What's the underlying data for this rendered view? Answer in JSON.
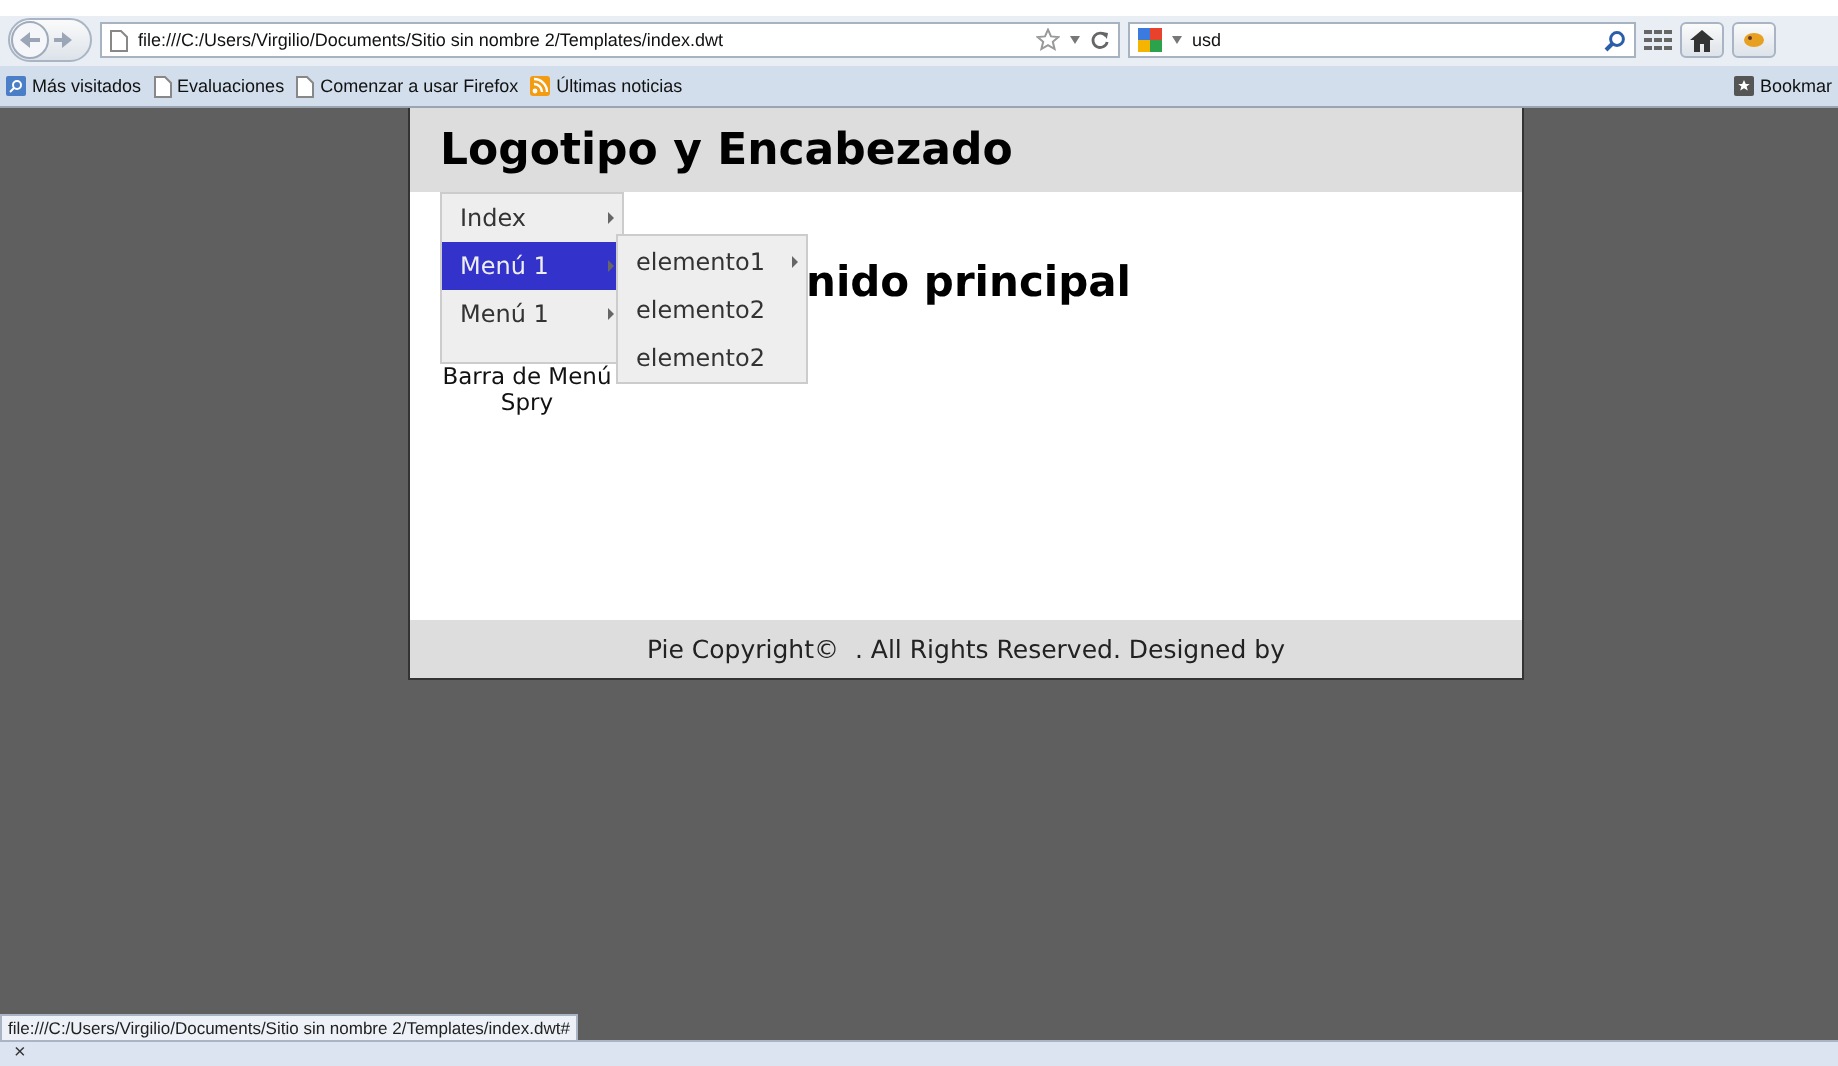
{
  "toolbar": {
    "address": "file:///C:/Users/Virgilio/Documents/Sitio sin nombre 2/Templates/index.dwt",
    "search_value": "usd"
  },
  "bookmarks": [
    {
      "label": "Más visitados",
      "kind": "smart"
    },
    {
      "label": "Evaluaciones",
      "kind": "page"
    },
    {
      "label": "Comenzar a usar Firefox",
      "kind": "page"
    },
    {
      "label": "Últimas noticias",
      "kind": "feed"
    }
  ],
  "bookmarks_menu": "Bookmar",
  "page": {
    "header": "Logotipo y Encabezado",
    "menu": [
      {
        "label": "Index",
        "selected": false
      },
      {
        "label": "Menú 1",
        "selected": true
      },
      {
        "label": "Menú 1",
        "selected": false
      }
    ],
    "submenu": [
      {
        "label": "elemento1",
        "has_submenu": true
      },
      {
        "label": "elemento2",
        "has_submenu": false
      },
      {
        "label": "elemento2",
        "has_submenu": false
      }
    ],
    "menu_caption": "Barra de Menú Spry",
    "main_heading": "nido principal",
    "footer": "Pie Copyright©  . All Rights Reserved. Designed by"
  },
  "status_url": "file:///C:/Users/Virgilio/Documents/Sitio sin nombre 2/Templates/index.dwt#",
  "findbar": {
    "close": "×"
  }
}
